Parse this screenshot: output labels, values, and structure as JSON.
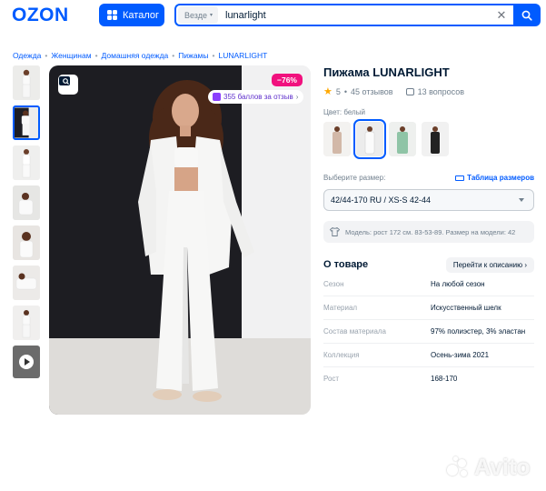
{
  "header": {
    "logo": "OZON",
    "catalog_label": "Каталог",
    "search_scope": "Везде",
    "search_value": "lunarlight"
  },
  "breadcrumbs": [
    "Одежда",
    "Женщинам",
    "Домашняя одежда",
    "Пижамы",
    "LUNARLIGHT"
  ],
  "gallery": {
    "discount": "−76%",
    "points_badge": "355 баллов за отзыв"
  },
  "product": {
    "title": "Пижама LUNARLIGHT",
    "rating": "5",
    "reviews": "45 отзывов",
    "questions": "13 вопросов",
    "color_label": "Цвет: белый",
    "size_label": "Выберите размер:",
    "size_table_label": "Таблица размеров",
    "selected_size": "42/44-170 RU / XS-S 42-44",
    "model_info": "Модель: рост 172 см. 83-53-89. Размер на модели: 42"
  },
  "about": {
    "title": "О товаре",
    "link": "Перейти к описанию",
    "specs": [
      {
        "key": "Сезон",
        "value": "На любой сезон"
      },
      {
        "key": "Материал",
        "value": "Искусственный шелк"
      },
      {
        "key": "Состав материала",
        "value": "97% полиэстер, 3% эластан"
      },
      {
        "key": "Коллекция",
        "value": "Осень-зима 2021"
      },
      {
        "key": "Рост",
        "value": "168-170"
      }
    ]
  },
  "watermark": "Avito",
  "colors": {
    "accent": "#005bff",
    "discount": "#f1117e",
    "star": "#ffa800",
    "points": "#8b3ffd"
  }
}
